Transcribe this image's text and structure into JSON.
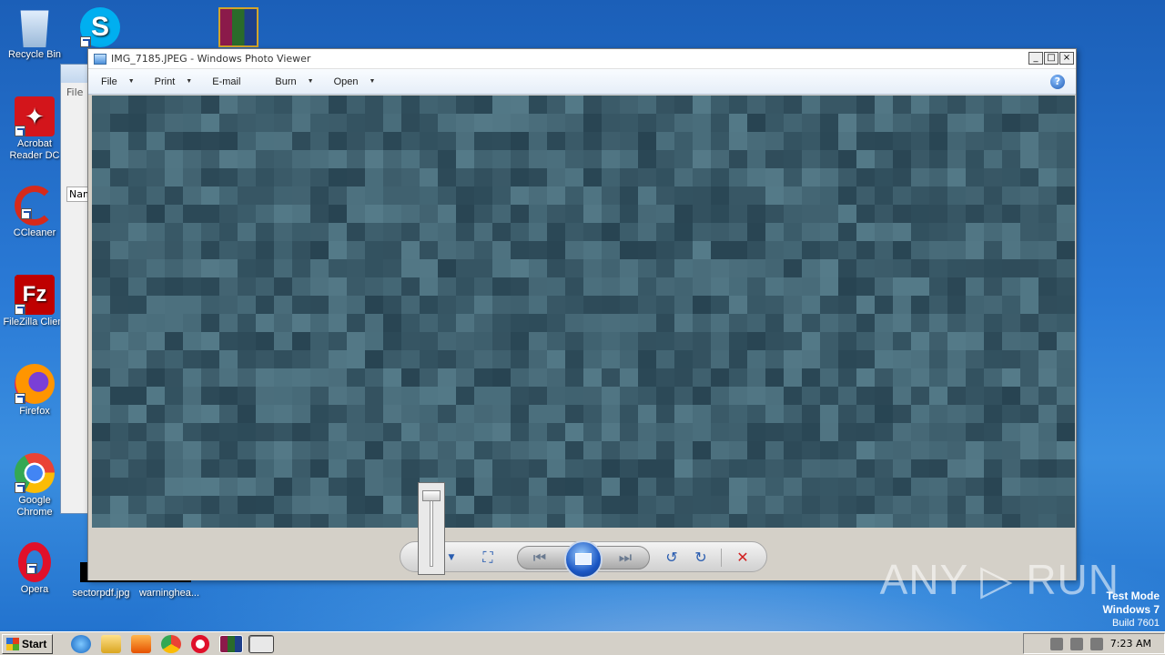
{
  "desktop": {
    "icons": [
      {
        "label": "Recycle Bin",
        "icon": "recycle-bin-icon"
      },
      {
        "label": "Acrobat Reader DC",
        "icon": "acrobat-icon"
      },
      {
        "label": "CCleaner",
        "icon": "ccleaner-icon"
      },
      {
        "label": "FileZilla Client",
        "icon": "filezilla-icon"
      },
      {
        "label": "Firefox",
        "icon": "firefox-icon"
      },
      {
        "label": "Google Chrome",
        "icon": "chrome-icon"
      },
      {
        "label": "Opera",
        "icon": "opera-icon"
      },
      {
        "label": "sectorpdf.jpg",
        "icon": "image-file-icon"
      },
      {
        "label": "warninghea...",
        "icon": "file-icon"
      }
    ]
  },
  "background_window": {
    "menu_label": "File",
    "column_header": "Nam"
  },
  "viewer": {
    "title": "IMG_7185.JPEG - Windows Photo Viewer",
    "menu": [
      {
        "label": "File"
      },
      {
        "label": "Print"
      },
      {
        "label": "E-mail"
      },
      {
        "label": "Burn"
      },
      {
        "label": "Open"
      }
    ],
    "help_glyph": "?"
  },
  "watermark": "ANY ▷ RUN",
  "system": {
    "test_mode_line1": "Test Mode",
    "test_mode_line2": "Windows 7",
    "test_mode_line3": "Build 7601",
    "clock": "7:23 AM"
  },
  "taskbar": {
    "start_label": "Start"
  },
  "colors": {
    "desktop_blue": "#1f6fcc",
    "photo_base": "#3d5c6c",
    "delete_red": "#d22020"
  }
}
